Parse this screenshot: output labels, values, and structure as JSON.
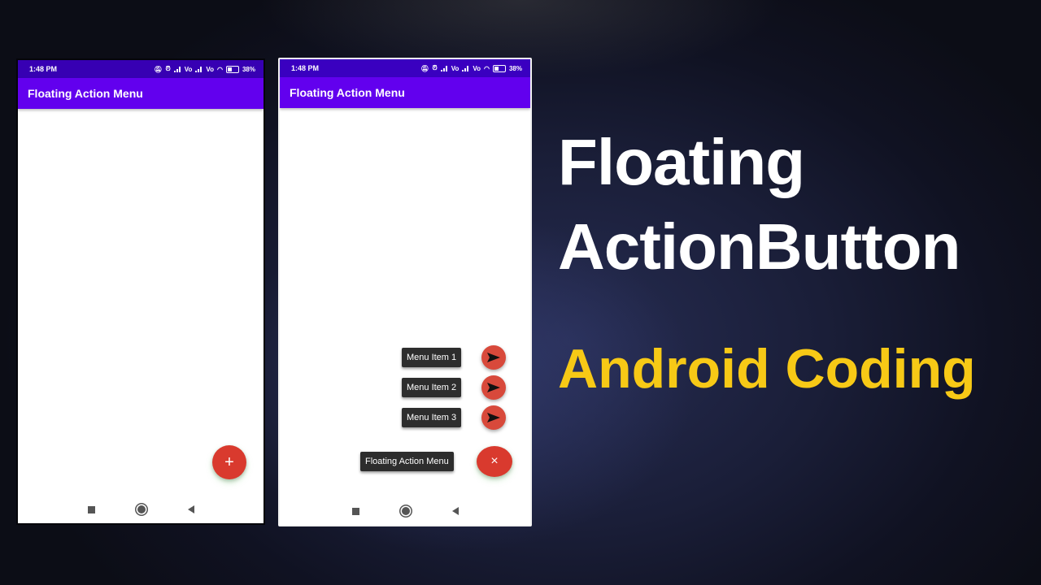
{
  "phones": [
    {
      "state": "collapsed",
      "status_bar": {
        "time": "1:48 PM",
        "battery": "38%"
      },
      "app_bar": {
        "title": "Floating Action Menu"
      },
      "fab": {
        "icon": "plus-icon",
        "glyph": "+"
      }
    },
    {
      "state": "expanded",
      "status_bar": {
        "time": "1:48 PM",
        "battery": "38%"
      },
      "app_bar": {
        "title": "Floating Action Menu"
      },
      "menu_items": [
        {
          "label": "Menu Item 1",
          "icon": "send-icon"
        },
        {
          "label": "Menu Item 2",
          "icon": "send-icon"
        },
        {
          "label": "Menu Item 3",
          "icon": "send-icon"
        }
      ],
      "fab": {
        "label": "Floating Action Menu",
        "icon": "close-icon",
        "glyph": "×"
      }
    }
  ],
  "headline": {
    "line1": "Floating",
    "line2": "ActionButton",
    "subtitle": "Android Coding"
  },
  "colors": {
    "app_bar": "#6200ee",
    "status_bar": "#3700b3",
    "fab": "#d93a2e",
    "subtitle": "#f7c916"
  }
}
